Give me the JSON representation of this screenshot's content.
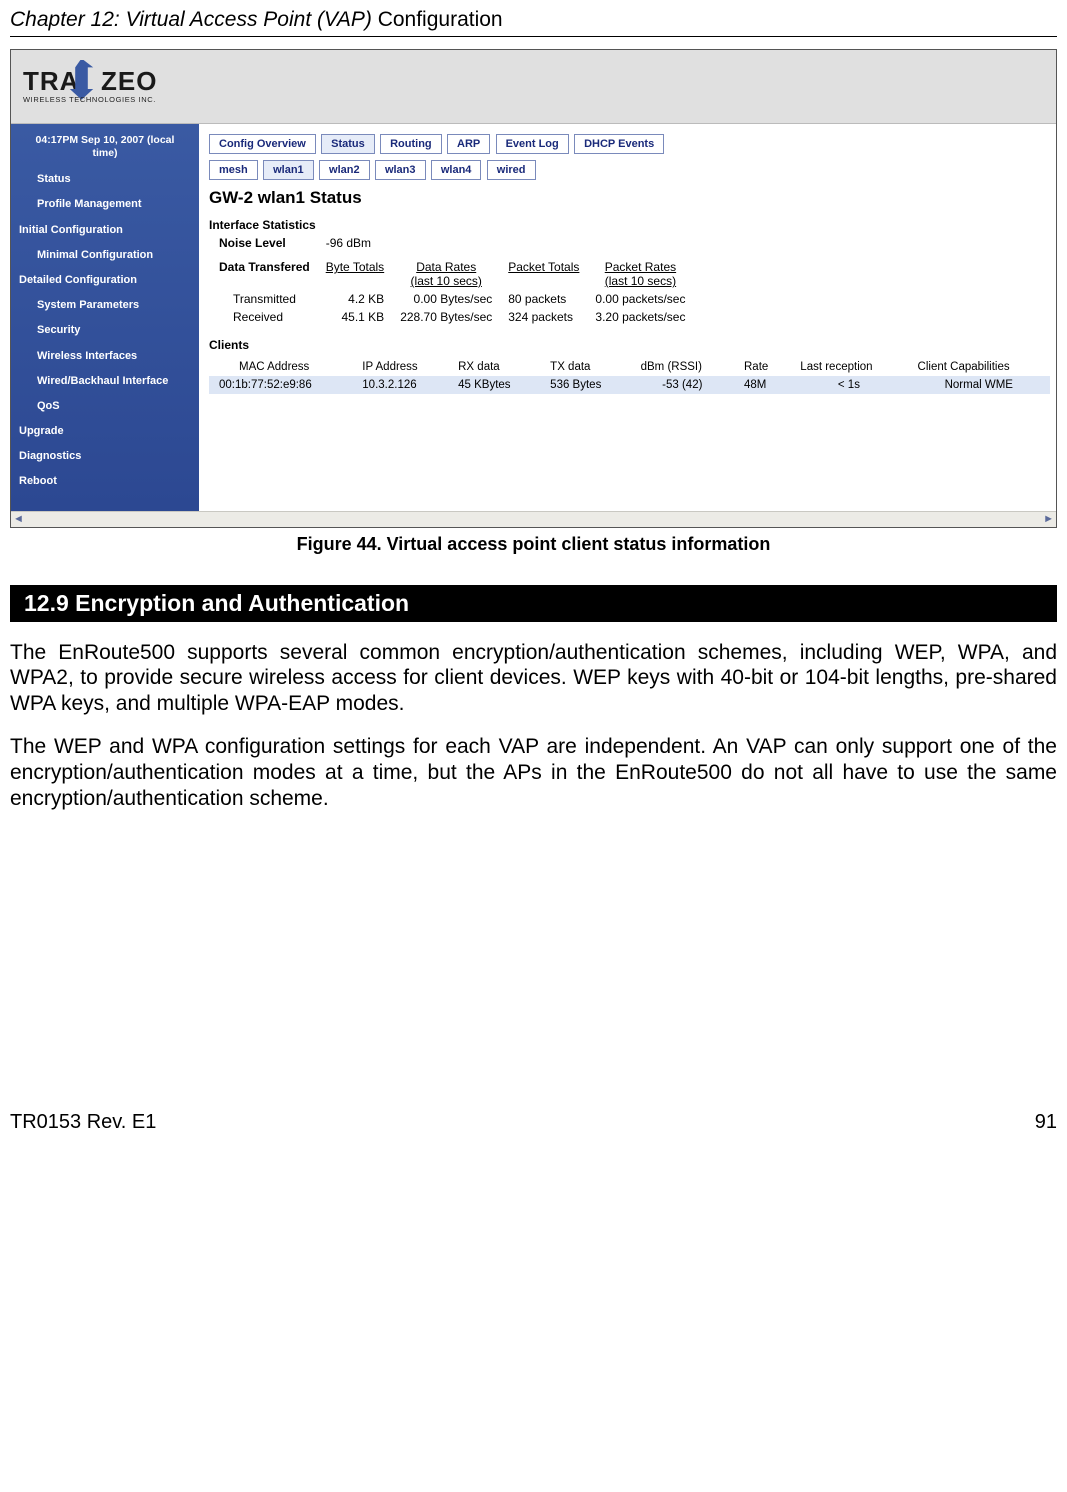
{
  "page": {
    "chapter_italic": "Chapter 12: Virtual Access Point (VAP) ",
    "chapter_plain": "Configuration",
    "footer_left": "TR0153 Rev. E1",
    "footer_right": "91"
  },
  "figure_caption": "Figure 44. Virtual access point client status information",
  "section_bar": "12.9    Encryption and Authentication",
  "paragraph1": "The EnRoute500 supports several common encryption/authentication schemes, including WEP, WPA, and WPA2, to provide secure wireless access for client devices. WEP keys with 40-bit or 104-bit lengths, pre-shared WPA keys, and multiple WPA-EAP modes.",
  "paragraph2": "The WEP and WPA configuration settings for each VAP are independent. An VAP can only support one of the encryption/authentication modes at a time, but the APs in the EnRoute500 do not all have to use the same encryption/authentication scheme.",
  "logo": {
    "brand_upper": "TRA",
    "brand_upper2": "ZEO",
    "brand_sub": "WIRELESS  TECHNOLOGIES INC."
  },
  "sidebar": {
    "time_l1": "04:17PM Sep 10, 2007 (local",
    "time_l2": "time)",
    "items": [
      "Status",
      "Profile Management",
      "Initial Configuration",
      "Minimal Configuration",
      "Detailed Configuration",
      "System Parameters",
      "Security",
      "Wireless Interfaces",
      "Wired/Backhaul Interface",
      "QoS",
      "Upgrade",
      "Diagnostics",
      "Reboot"
    ]
  },
  "top_tabs": [
    "Config Overview",
    "Status",
    "Routing",
    "ARP",
    "Event Log",
    "DHCP Events"
  ],
  "iface_tabs": [
    "mesh",
    "wlan1",
    "wlan2",
    "wlan3",
    "wlan4",
    "wired"
  ],
  "content": {
    "title": "GW-2 wlan1 Status",
    "stats_head": "Interface Statistics",
    "noise_label": "Noise Level",
    "noise_value": "-96 dBm",
    "dt_label": "Data Transfered",
    "cols": {
      "byte": "Byte Totals",
      "rate1": "Data Rates",
      "rate2": "(last 10 secs)",
      "pkt": "Packet Totals",
      "prate1": "Packet Rates",
      "prate2": "(last 10 secs)"
    },
    "tx_label": "Transmitted",
    "tx": {
      "bytes": "4.2 KB",
      "rate": "0.00 Bytes/sec",
      "pkts": "80 packets",
      "prate": "0.00 packets/sec"
    },
    "rx_label": "Received",
    "rx": {
      "bytes": "45.1 KB",
      "rate": "228.70 Bytes/sec",
      "pkts": "324 packets",
      "prate": "3.20 packets/sec"
    },
    "clients_head": "Clients",
    "client_cols": [
      "MAC Address",
      "IP Address",
      "RX data",
      "TX data",
      "dBm (RSSI)",
      "Rate",
      "Last reception",
      "Client Capabilities"
    ],
    "client_row": [
      "00:1b:77:52:e9:86",
      "10.3.2.126",
      "45 KBytes",
      "536 Bytes",
      "-53 (42)",
      "48M",
      "< 1s",
      "Normal WME"
    ]
  }
}
